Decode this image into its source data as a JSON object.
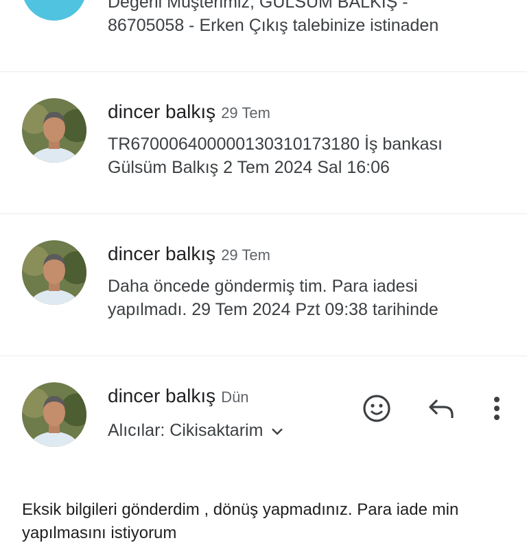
{
  "messages": [
    {
      "snippet_lines": [
        "Değerli Müşterimiz, GÜLSÜM BALKIŞ -",
        "86705058 - Erken Çıkış talebinize istinaden"
      ]
    },
    {
      "sender": "dincer balkış",
      "date": "29 Tem",
      "snippet_lines": [
        "TR670006400000130310173180 İş bankası",
        "Gülsüm Balkış 2 Tem 2024 Sal 16:06"
      ]
    },
    {
      "sender": "dincer balkış",
      "date": "29 Tem",
      "snippet_lines": [
        "Daha öncede göndermiş tim. Para iadesi",
        "yapılmadı. 29 Tem 2024 Pzt 09:38 tarihinde"
      ]
    }
  ],
  "open_message": {
    "sender": "dincer balkış",
    "date": "Dün",
    "recipients": "Alıcılar: Cikisaktarim",
    "body_lines": [
      "Eksik bilgileri gönderdim , dönüş yapmadınız. Para iade min",
      "yapılmasını istiyorum"
    ]
  },
  "icons": {
    "emoji": "emoji-reaction-icon",
    "reply": "reply-icon",
    "more": "more-vertical-icon",
    "expand": "chevron-down-icon"
  },
  "colors": {
    "teal_avatar": "#4fc3df",
    "divider": "#ececec",
    "icon": "#3c4043"
  }
}
